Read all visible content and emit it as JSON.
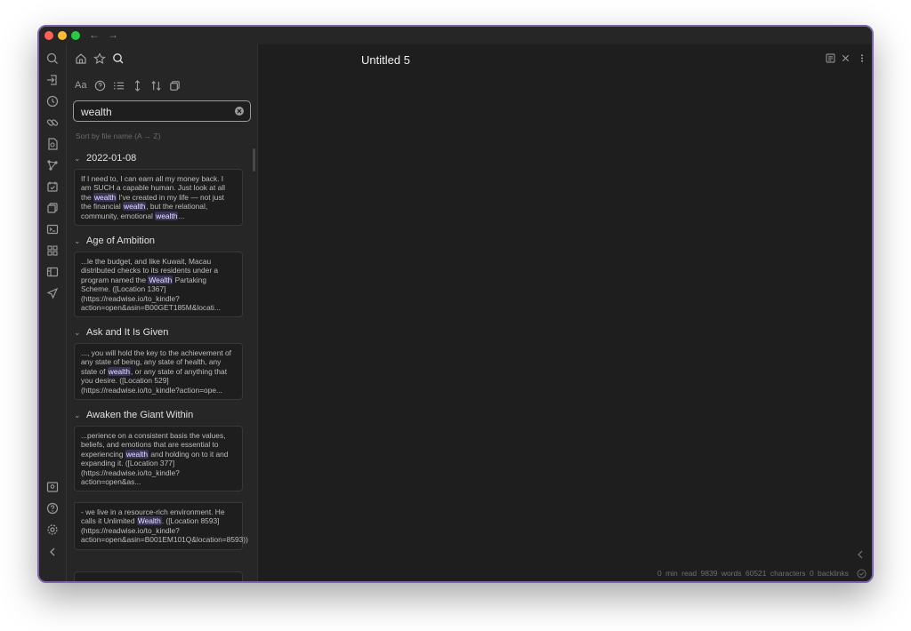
{
  "document": {
    "title": "Untitled 5"
  },
  "search": {
    "query": "wealth"
  },
  "sort_label": "Sort by file name (A → Z)",
  "results": [
    {
      "title": "2022-01-08",
      "snippets": [
        [
          {
            "t": "If I need to, I can earn all my money back. I am SUCH a capable human. Just look at all the "
          },
          {
            "t": "wealth",
            "h": true
          },
          {
            "t": " I've created in my life — not just the financial "
          },
          {
            "t": "wealth",
            "h": true
          },
          {
            "t": ", but the relational, community, emotional "
          },
          {
            "t": "wealth",
            "h": true
          },
          {
            "t": "..."
          }
        ]
      ]
    },
    {
      "title": "Age of Ambition",
      "snippets": [
        [
          {
            "t": "...le the budget, and like Kuwait, Macau distributed checks to its residents under a program named the "
          },
          {
            "t": "Wealth",
            "h": true
          },
          {
            "t": " Partaking Scheme. ([Location 1367](https://readwise.io/to_kindle?action=open&asin=B00GET185M&locati..."
          }
        ]
      ]
    },
    {
      "title": "Ask and It Is Given",
      "snippets": [
        [
          {
            "t": "..., you will hold the key to the achievement of any state of being, any state of health, any state of "
          },
          {
            "t": "wealth",
            "h": true
          },
          {
            "t": ", or any state of anything that you desire. ([Location 529](https://readwise.io/to_kindle?action=ope..."
          }
        ]
      ]
    },
    {
      "title": "Awaken the Giant Within",
      "snippets": [
        [
          {
            "t": "...perience on a consistent basis the values, beliefs, and emotions that are essential to experiencing "
          },
          {
            "t": "wealth",
            "h": true
          },
          {
            "t": " and holding on to it and expanding it. ([Location 377](https://readwise.io/to_kindle?action=open&as..."
          }
        ],
        [
          {
            "t": "- we live in a resource-rich environment. He calls it Unlimited "
          },
          {
            "t": "Wealth",
            "h": true
          },
          {
            "t": ". ([Location 8593](https://readwise.io/to_kindle?action=open&asin=B001EM101Q&location=8593))"
          }
        ]
      ]
    }
  ],
  "status_bar": {
    "read_time": "0 min read",
    "words": "9839 words",
    "characters": "60521 characters",
    "backlinks": "0 backlinks"
  },
  "ribbon_icons": [
    "search-icon",
    "open-file-icon",
    "clock-icon",
    "link-icon",
    "file-search-icon",
    "graph-icon",
    "calendar-icon",
    "copy-icon",
    "terminal-icon",
    "grid-icon",
    "layout-icon",
    "send-icon"
  ],
  "ribbon_bottom_icons": [
    "vault-icon",
    "help-icon",
    "settings-icon",
    "collapse-icon"
  ],
  "colors": {
    "accent": "#7a66a8",
    "highlight": "#3a3358",
    "background": "#1e1e1e",
    "panel": "#262626"
  }
}
